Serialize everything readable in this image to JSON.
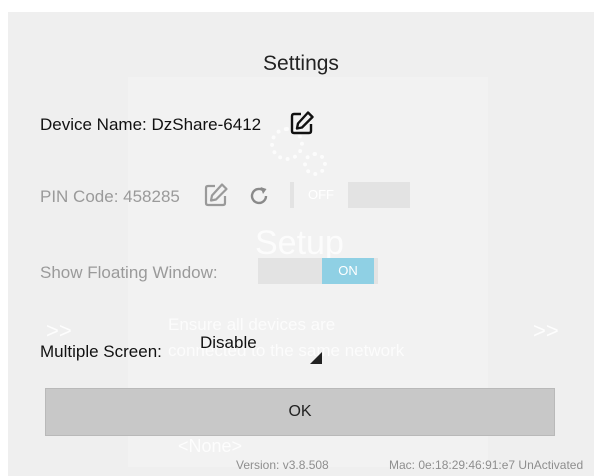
{
  "dialog": {
    "title": "Settings",
    "device_name": {
      "label": "Device Name: DzShare-6412"
    },
    "pin_code": {
      "label": "PIN Code: 458285",
      "toggle": {
        "value": "OFF",
        "state": "off"
      }
    },
    "floating_window": {
      "label": "Show Floating Window:",
      "toggle": {
        "value": "ON",
        "state": "on"
      }
    },
    "multiple_screen": {
      "label": "Multiple Screen:",
      "value": "Disable"
    },
    "ok_label": "OK"
  },
  "background": {
    "setup_text": "Setup",
    "instructions": "Ensure all devices are connected to the same network",
    "none_text": "<None>",
    "arrow_left": ">>",
    "arrow_right": ">>"
  },
  "footer": {
    "version": "Version: v3.8.508",
    "mac": "Mac: 0e:18:29:46:91:e7 UnActivated"
  },
  "colors": {
    "dialog_bg": "#efefef",
    "toggle_on": "#8fd0e4",
    "toggle_off": "#e3e3e3",
    "button_bg": "#c8c8c8"
  },
  "icons": [
    "edit-icon",
    "refresh-icon",
    "gear-icon"
  ]
}
